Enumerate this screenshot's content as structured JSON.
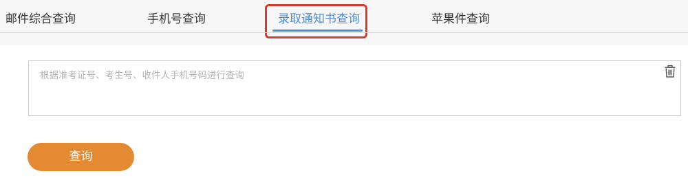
{
  "tabs": [
    {
      "label": "邮件综合查询",
      "active": false
    },
    {
      "label": "手机号查询",
      "active": false
    },
    {
      "label": "录取通知书查询",
      "active": true
    },
    {
      "label": "苹果件查询",
      "active": false
    }
  ],
  "query": {
    "placeholder": "根据准考证号、考生号、收件人手机号码进行查询",
    "value": "",
    "clear_icon": "trash-icon"
  },
  "submit": {
    "label": "查询"
  },
  "colors": {
    "active_tab": "#4a8fd8",
    "highlight_frame": "#d93a2b",
    "button": "#e38a32",
    "tab_bar_bg": "#f7f7f7"
  }
}
